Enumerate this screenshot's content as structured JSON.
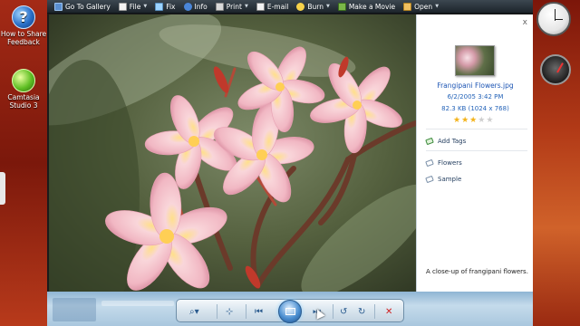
{
  "desktop": {
    "icons": [
      {
        "label": "How to Share Feedback"
      },
      {
        "label": "Camtasia Studio 3"
      }
    ]
  },
  "toolbar": {
    "items": [
      {
        "label": "Go To Gallery",
        "icon": "gallery-icon"
      },
      {
        "label": "File",
        "icon": "file-icon",
        "has_menu": true
      },
      {
        "label": "Fix",
        "icon": "fix-icon"
      },
      {
        "label": "Info",
        "icon": "info-icon"
      },
      {
        "label": "Print",
        "icon": "print-icon",
        "has_menu": true
      },
      {
        "label": "E-mail",
        "icon": "email-icon"
      },
      {
        "label": "Burn",
        "icon": "burn-icon",
        "has_menu": true
      },
      {
        "label": "Make a Movie",
        "icon": "movie-icon"
      },
      {
        "label": "Open",
        "icon": "open-icon",
        "has_menu": true
      }
    ],
    "caret": "▼"
  },
  "info_pane": {
    "close": "x",
    "file_name": "Frangipani Flowers.jpg",
    "date_time": "6/2/2005   3:42 PM",
    "size_dims": "82.3 KB (1024 x 768)",
    "rating": 3,
    "rating_max": 5,
    "add_tags": "Add Tags",
    "tags": [
      "Flowers",
      "Sample"
    ],
    "caption": "A close-up of frangipani flowers."
  },
  "controls": {
    "buttons": [
      "zoom-icon",
      "fit-window-icon",
      "previous-icon",
      "slideshow-icon",
      "next-icon",
      "rotate-ccw-icon",
      "rotate-cw-icon",
      "delete-icon"
    ]
  },
  "colors": {
    "toolbar_bg": "#1c242b",
    "link_blue": "#1c55b4",
    "star_on": "#f3b31c",
    "delete_red": "#d02020"
  }
}
